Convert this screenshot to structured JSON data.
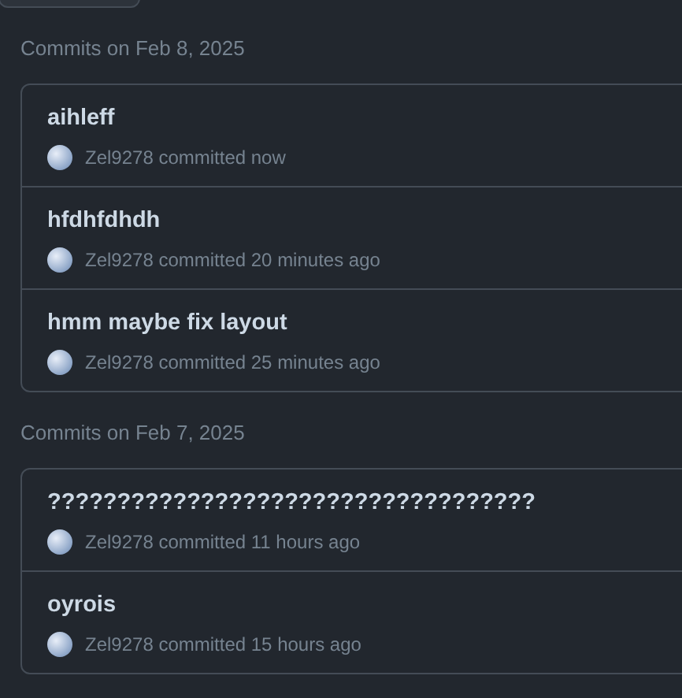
{
  "groups": [
    {
      "heading": "Commits on Feb 8, 2025",
      "commits": [
        {
          "title": "aihleff",
          "author": "Zel9278",
          "time": "committed now"
        },
        {
          "title": "hfdhfdhdh",
          "author": "Zel9278",
          "time": "committed 20 minutes ago"
        },
        {
          "title": "hmm maybe fix layout",
          "author": "Zel9278",
          "time": "committed 25 minutes ago"
        }
      ]
    },
    {
      "heading": "Commits on Feb 7, 2025",
      "commits": [
        {
          "title": "???????????????????????????????????",
          "author": "Zel9278",
          "time": "committed 11 hours ago"
        },
        {
          "title": "oyrois",
          "author": "Zel9278",
          "time": "committed 15 hours ago"
        }
      ]
    }
  ]
}
